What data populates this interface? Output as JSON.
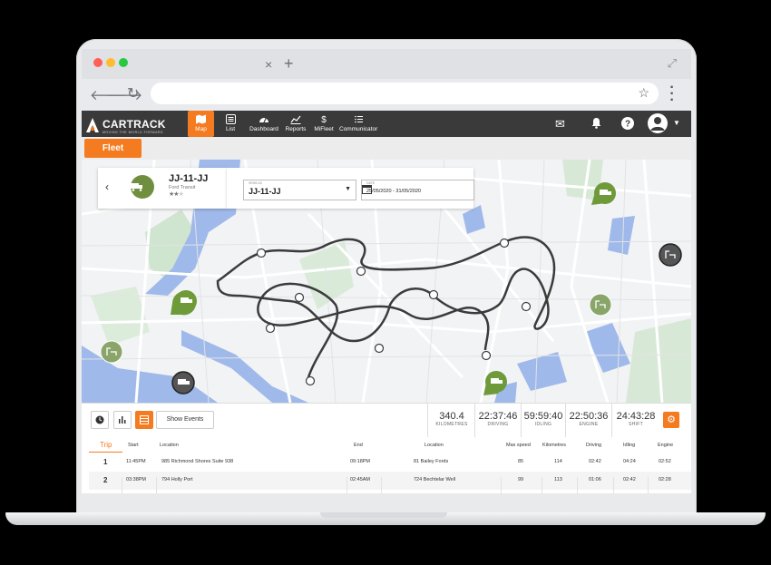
{
  "browser": {
    "tab_close": "×",
    "tab_add": "+"
  },
  "app": {
    "brand": "CARTRACK",
    "tagline": "MOVING THE WORLD FORWARD",
    "nav": [
      {
        "label": "Map",
        "icon": "map-icon",
        "active": true
      },
      {
        "label": "List",
        "icon": "list-icon",
        "active": false
      },
      {
        "label": "Dashboard",
        "icon": "dashboard-icon",
        "active": false
      },
      {
        "label": "Reports",
        "icon": "reports-icon",
        "active": false
      },
      {
        "label": "MiFleet",
        "icon": "dollar-icon",
        "active": false
      },
      {
        "label": "Communicator",
        "icon": "communicator-icon",
        "active": false
      }
    ],
    "fleet_button": "Fleet",
    "accent": "#f47b20",
    "nav_bg": "#3a3a3a"
  },
  "vehicle": {
    "registration": "JJ-11-JJ",
    "model": "Ford Transit",
    "rating_stars": 2,
    "rating_max": 3
  },
  "filters": {
    "vehicle_label": "VEHICLE",
    "vehicle_value": "JJ-11-JJ",
    "date_label": "DATE",
    "date_value": "25/05/2020 - 31/05/2020"
  },
  "toolbar": {
    "show_events": "Show Events"
  },
  "stats": [
    {
      "value": "340.4",
      "label": "KILOMETRES"
    },
    {
      "value": "22:37:46",
      "label": "DRIVING"
    },
    {
      "value": "59:59:40",
      "label": "IDLING"
    },
    {
      "value": "22:50:36",
      "label": "ENGINE"
    },
    {
      "value": "24:43:28",
      "label": "SHIFT"
    }
  ],
  "table": {
    "headers": {
      "trip": "Trip",
      "start": "Start",
      "location_start": "Location",
      "end": "End",
      "location_end": "Location",
      "max_speed": "Max speed",
      "kilometres": "Kilometres",
      "driving": "Driving",
      "idling": "Idling",
      "engine": "Engine"
    },
    "rows": [
      {
        "trip": "1",
        "start": "11:45PM",
        "loc_start": "985 Richmond Shores Suite 938",
        "end": "09:18PM",
        "loc_end": "81 Bailey Fords",
        "max_speed": "85",
        "km": "114",
        "driving": "02:42",
        "idling": "04:24",
        "engine": "02:52"
      },
      {
        "trip": "2",
        "start": "03:38PM",
        "loc_start": "794 Holly Port",
        "end": "02:45AM",
        "loc_end": "724 Bechtelar Well",
        "max_speed": "99",
        "km": "113",
        "driving": "01:06",
        "idling": "02:42",
        "engine": "02:28"
      }
    ]
  },
  "map": {
    "route_color": "#3b3b3b",
    "marker_active_color": "#6f9a3a",
    "marker_idle_color": "#8aa56a",
    "water_color": "#9fb9ea",
    "park_color": "#cfe5cf"
  }
}
